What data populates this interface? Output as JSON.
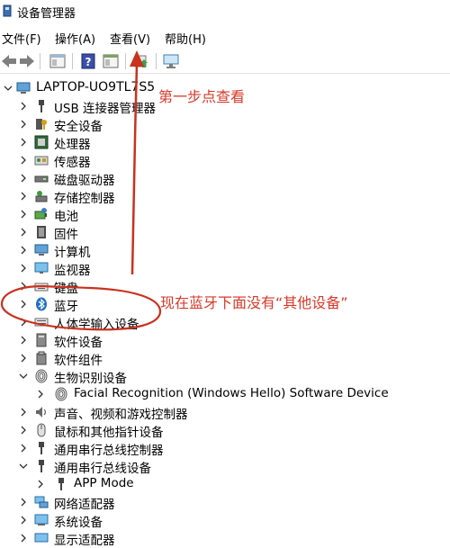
{
  "window": {
    "title": "设备管理器"
  },
  "menu": {
    "file": "文件(F)",
    "action": "操作(A)",
    "view": "查看(V)",
    "help": "帮助(H)"
  },
  "toolbar": {
    "buttons": [
      "back-icon",
      "forward-icon",
      "properties-icon",
      "help-icon",
      "show-hide-icon",
      "update-driver-icon",
      "scan-hardware-icon"
    ]
  },
  "tree": {
    "root": "LAPTOP-UO9TL7S5",
    "items": [
      {
        "label": "USB 连接器管理器",
        "icon": "usb-connector-icon",
        "expanded": false
      },
      {
        "label": "安全设备",
        "icon": "security-key-icon",
        "expanded": false
      },
      {
        "label": "处理器",
        "icon": "processor-icon",
        "expanded": false
      },
      {
        "label": "传感器",
        "icon": "sensor-icon",
        "expanded": false
      },
      {
        "label": "磁盘驱动器",
        "icon": "disk-drive-icon",
        "expanded": false
      },
      {
        "label": "存储控制器",
        "icon": "storage-controller-icon",
        "expanded": false
      },
      {
        "label": "电池",
        "icon": "battery-icon",
        "expanded": false
      },
      {
        "label": "固件",
        "icon": "firmware-icon",
        "expanded": false
      },
      {
        "label": "计算机",
        "icon": "computer-icon",
        "expanded": false
      },
      {
        "label": "监视器",
        "icon": "monitor-icon",
        "expanded": false
      },
      {
        "label": "键盘",
        "icon": "keyboard-icon",
        "expanded": false
      },
      {
        "label": "蓝牙",
        "icon": "bluetooth-icon",
        "expanded": false
      },
      {
        "label": "人体学输入设备",
        "icon": "hid-icon",
        "expanded": false
      },
      {
        "label": "软件设备",
        "icon": "software-device-icon",
        "expanded": false
      },
      {
        "label": "软件组件",
        "icon": "software-component-icon",
        "expanded": false
      },
      {
        "label": "生物识别设备",
        "icon": "fingerprint-icon",
        "expanded": true
      },
      {
        "label": "Facial Recognition (Windows Hello) Software Device",
        "icon": "fingerprint-icon",
        "child": true
      },
      {
        "label": "声音、视频和游戏控制器",
        "icon": "speaker-icon",
        "expanded": false
      },
      {
        "label": "鼠标和其他指针设备",
        "icon": "mouse-icon",
        "expanded": false
      },
      {
        "label": "通用串行总线控制器",
        "icon": "usb-controller-icon",
        "expanded": false
      },
      {
        "label": "通用串行总线设备",
        "icon": "usb-device-icon",
        "expanded": true
      },
      {
        "label": "APP Mode",
        "icon": "usb-device-icon",
        "child": true
      },
      {
        "label": "网络适配器",
        "icon": "network-adapter-icon",
        "expanded": false
      },
      {
        "label": "系统设备",
        "icon": "system-device-icon",
        "expanded": false
      },
      {
        "label": "显示适配器",
        "icon": "display-adapter-icon",
        "expanded": false
      }
    ]
  },
  "annotations": {
    "step1": "第一步点查看",
    "bluetooth_note": "现在蓝牙下面没有“其他设备”",
    "color": "#d63a2a"
  }
}
